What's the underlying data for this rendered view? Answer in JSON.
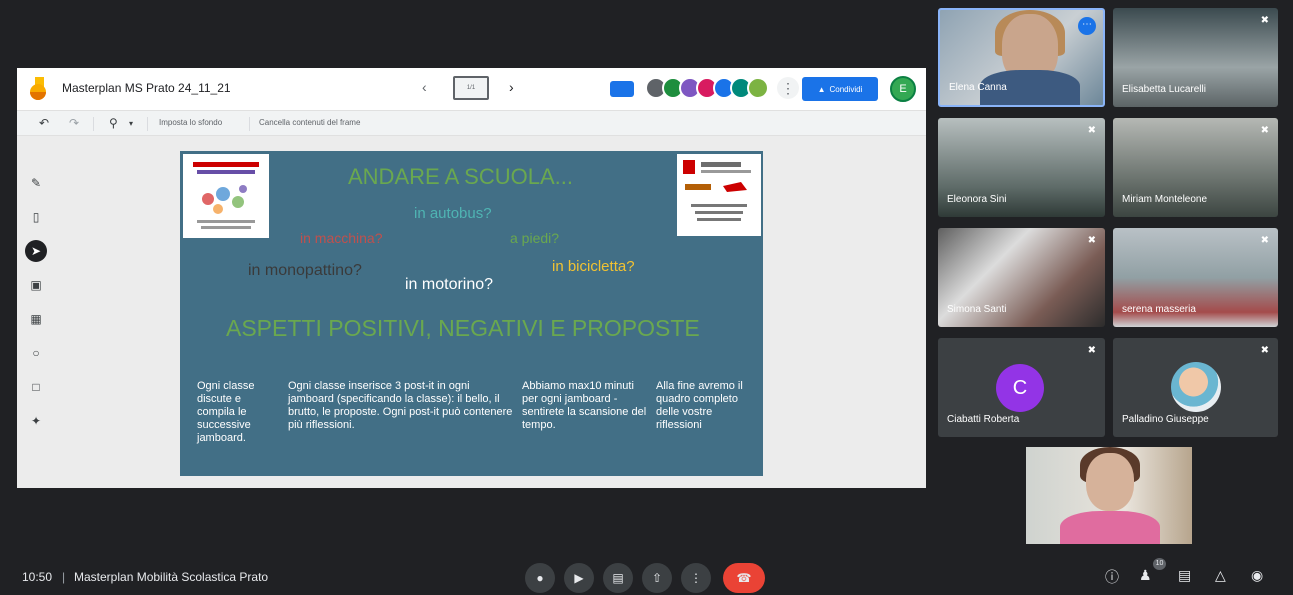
{
  "jamboard": {
    "title": "Masterplan MS Prato 24_11_21",
    "prev_label": "‹",
    "next_label": "›",
    "frame_label": "1/1",
    "more_label": "⋮",
    "share_label": "Condividi",
    "profile_initial": "E",
    "toolbar": {
      "set_background": "Imposta lo sfondo",
      "clear_frame": "Cancella contenuti del frame"
    }
  },
  "slide": {
    "title": "ANDARE A SCUOLA...",
    "options": {
      "autobus": "in autobus?",
      "macchina": "in macchina?",
      "piedi": "a piedi?",
      "monopattino": "in monopattino?",
      "bicicletta": "in bicicletta?",
      "motorino": "in motorino?"
    },
    "subtitle": "ASPETTI POSITIVI, NEGATIVI E PROPOSTE",
    "columns": [
      "Ogni classe discute e compila le successive jamboard.",
      "Ogni classe inserisce 3 post-it in ogni jamboard (specificando la classe): il bello, il brutto, le proposte. Ogni post-it può contenere più riflessioni.",
      "Abbiamo max10 minuti per ogni jamboard - sentirete la scansione del tempo.",
      "Alla fine avremo il quadro completo delle vostre riflessioni"
    ]
  },
  "participants": [
    {
      "name": "Elena Canna"
    },
    {
      "name": "Elisabetta Lucarelli"
    },
    {
      "name": "Eleonora Sini"
    },
    {
      "name": "Miriam Monteleone"
    },
    {
      "name": "Simona Santi"
    },
    {
      "name": "serena masseria"
    },
    {
      "name": "Ciabatti Roberta",
      "initial": "C"
    },
    {
      "name": "Palladino Giuseppe"
    }
  ],
  "bottom": {
    "time": "10:50",
    "separator": "|",
    "meeting_name": "Masterplan Mobilità Scolastica Prato",
    "people_count": "10"
  },
  "colors": {
    "slide_bg": "#426f86",
    "accent": "#1a73e8",
    "end_call": "#ea4335",
    "title_green": "#6aa84f"
  }
}
